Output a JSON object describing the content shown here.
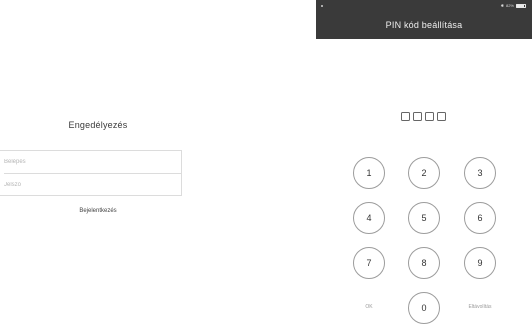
{
  "login": {
    "title": "Engedélyezés",
    "username_placeholder": "Belépés",
    "password_placeholder": "Jelszó",
    "submit_label": "Bejelentkezés"
  },
  "status_bar": {
    "carrier": "•",
    "battery_percent": "82%",
    "battery_level": 0.82
  },
  "pin_screen": {
    "title": "PIN kód beállítása",
    "pin_length": 4,
    "keys": [
      "1",
      "2",
      "3",
      "4",
      "5",
      "6",
      "7",
      "8",
      "9",
      "0"
    ],
    "ok_label": "OK",
    "clear_label": "Eltávolítás"
  }
}
